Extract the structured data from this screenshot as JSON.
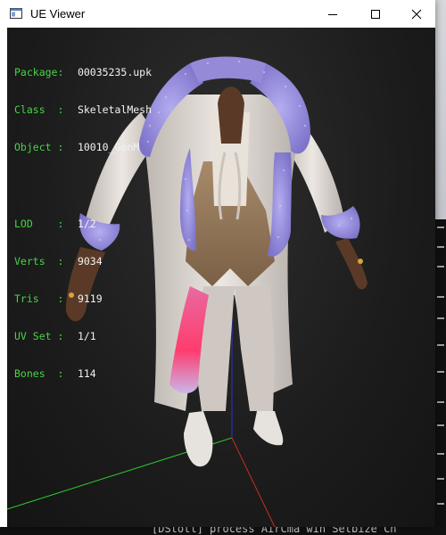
{
  "window": {
    "title": "UE Viewer",
    "icon": "app-window-icon",
    "controls": [
      "minimize-icon",
      "maximize-icon",
      "close-icon"
    ]
  },
  "info": {
    "package": {
      "key": "Package:",
      "value": "00035235.upk"
    },
    "class": {
      "key": "Class  :",
      "value": "SkeletalMesh"
    },
    "object": {
      "key": "Object :",
      "value": "10010_GonM"
    },
    "lod": {
      "key": "LOD    :",
      "value": "1/2"
    },
    "verts": {
      "key": "Verts  :",
      "value": "9034"
    },
    "tris": {
      "key": "Tris   :",
      "value": "9119"
    },
    "uvset": {
      "key": "UV Set :",
      "value": "1/1"
    },
    "bones": {
      "key": "Bones  :",
      "value": "114"
    }
  },
  "background": {
    "console_text": "[DStotl] process  AirCma win Setbize  Ch"
  },
  "colors": {
    "label": "#47d447",
    "value": "#f2f2f2",
    "viewport": "#1c1c1c",
    "fur": "#8f86d8",
    "coat": "#d9d3ce",
    "axis_x": "#cc2a2a",
    "axis_y": "#2fd12f",
    "axis_z": "#2a32d8"
  }
}
